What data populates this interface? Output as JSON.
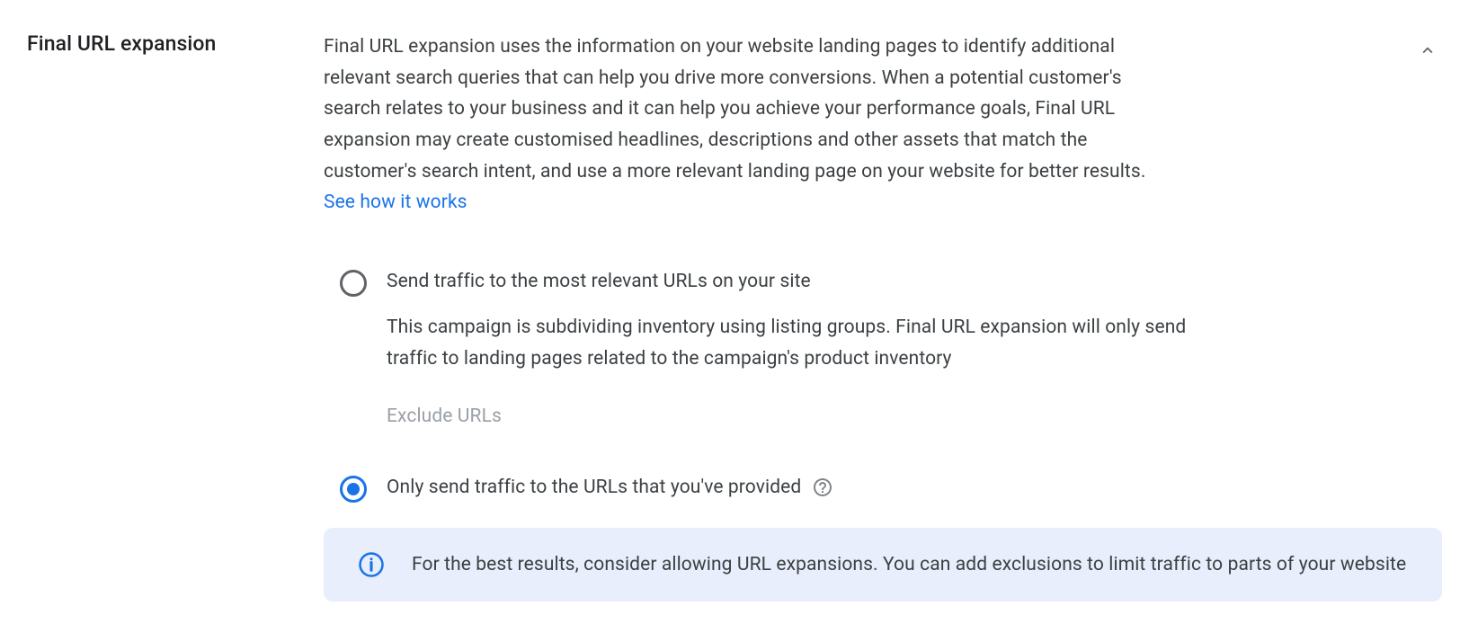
{
  "section": {
    "title": "Final URL expansion",
    "description": "Final URL expansion uses the information on your website landing pages to identify additional relevant search queries that can help you drive more conversions. When a potential customer's search relates to your business and it can help you achieve your performance goals, Final URL expansion may create customised headlines, descriptions and other assets that match the customer's search intent, and use a more relevant landing page on your website for better results. ",
    "link_text": "See how it works"
  },
  "options": {
    "option1": {
      "label": "Send traffic to the most relevant URLs on your site",
      "subtext": "This campaign is subdividing inventory using listing groups. Final URL expansion will only send traffic to landing pages related to the campaign's product inventory",
      "exclude_label": "Exclude URLs"
    },
    "option2": {
      "label": "Only send traffic to the URLs that you've provided"
    }
  },
  "info_banner": {
    "text": "For the best results, consider allowing URL expansions. You can add exclusions to limit traffic to parts of your website"
  }
}
